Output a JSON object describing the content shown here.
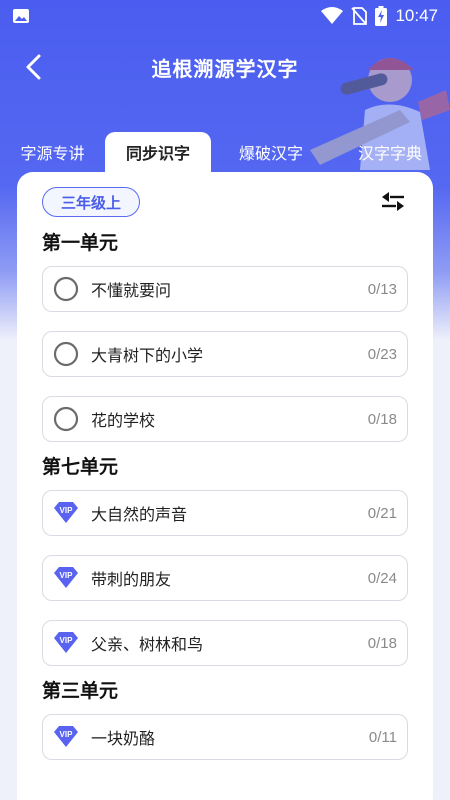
{
  "status_bar": {
    "time": "10:47"
  },
  "header": {
    "title": "追根溯源学汉字"
  },
  "tabs": [
    {
      "label": "字源专讲"
    },
    {
      "label": "同步识字",
      "selected": true
    },
    {
      "label": "爆破汉字"
    },
    {
      "label": "汉字字典"
    }
  ],
  "grade": {
    "label": "三年级上"
  },
  "colors": {
    "accent": "#4a5df0",
    "vip_badge": "#5a63f0"
  },
  "units": [
    {
      "title": "第一单元",
      "lessons": [
        {
          "name": "不懂就要问",
          "progress": "0/13",
          "icon": "radio-circle-icon"
        },
        {
          "name": "大青树下的小学",
          "progress": "0/23",
          "icon": "radio-circle-icon"
        },
        {
          "name": "花的学校",
          "progress": "0/18",
          "icon": "radio-circle-icon"
        }
      ]
    },
    {
      "title": "第七单元",
      "lessons": [
        {
          "name": "大自然的声音",
          "progress": "0/21",
          "icon": "vip-icon"
        },
        {
          "name": "带刺的朋友",
          "progress": "0/24",
          "icon": "vip-icon"
        },
        {
          "name": "父亲、树林和鸟",
          "progress": "0/18",
          "icon": "vip-icon"
        }
      ]
    },
    {
      "title": "第三单元",
      "lessons": [
        {
          "name": "一块奶酪",
          "progress": "0/11",
          "icon": "vip-icon"
        }
      ]
    }
  ]
}
